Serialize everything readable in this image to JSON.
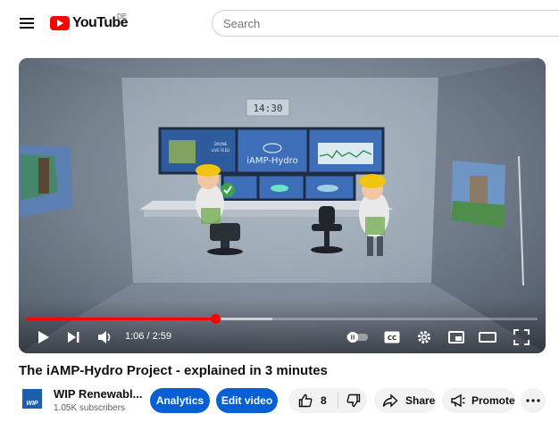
{
  "header": {
    "logo_text": "YouTube",
    "region": "DE",
    "search_placeholder": "Search"
  },
  "player": {
    "time_display": "1:06 / 2:59",
    "progress_played_fraction": 0.3687,
    "progress_buffered_fraction": 0.48,
    "scene": {
      "clock_text": "14:30",
      "screen_left_label_1": "DRONE",
      "screen_left_label_2": "LIVE FEED",
      "screen_center_label": "iAMP-Hydro"
    }
  },
  "video": {
    "title": "The iAMP-Hydro Project - explained in 3 minutes"
  },
  "channel": {
    "avatar_text": "WIP",
    "name": "WIP Renewabl...",
    "subscribers": "1.05K subscribers"
  },
  "actions": {
    "analytics_label": "Analytics",
    "edit_label": "Edit video",
    "like_count": "8",
    "share_label": "Share",
    "promote_label": "Promote"
  },
  "colors": {
    "brand_red": "#ff0000",
    "action_blue": "#065fd4"
  }
}
